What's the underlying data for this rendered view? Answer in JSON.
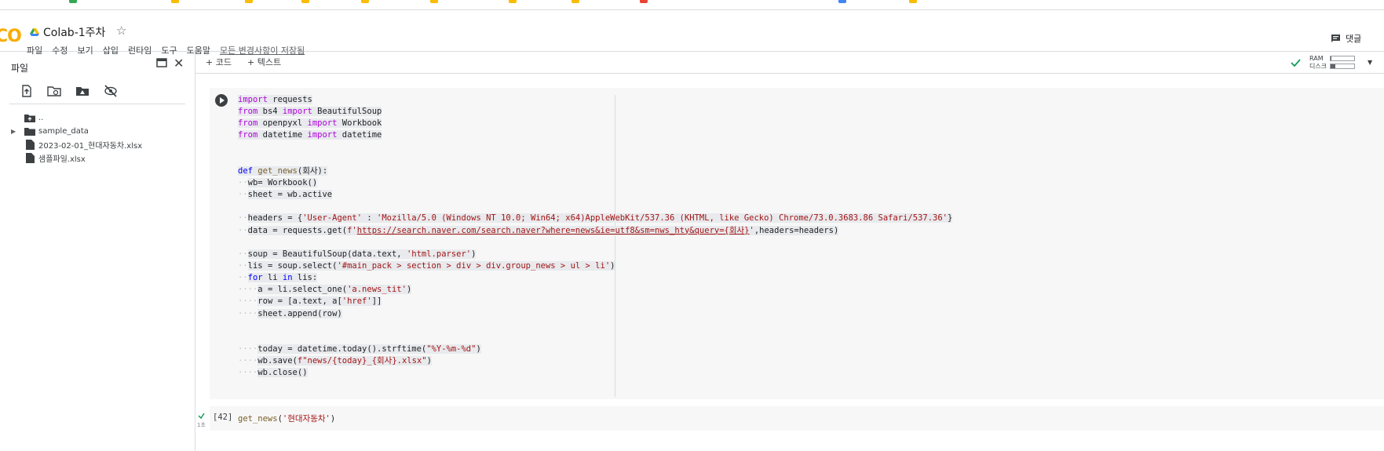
{
  "app": {
    "logo_text": "CO",
    "title": "Colab-1주차"
  },
  "menu": [
    "파일",
    "수정",
    "보기",
    "삽입",
    "런타임",
    "도구",
    "도움말"
  ],
  "saved_status": "모든 변경사항이 저장됨",
  "header": {
    "comments_label": "댓글"
  },
  "sidebar": {
    "title": "파일",
    "items": [
      {
        "label": "..",
        "icon": "folder-up-icon"
      },
      {
        "label": "sample_data",
        "icon": "folder-icon"
      },
      {
        "label": "2023-02-01_현대자동차.xlsx",
        "icon": "file-icon"
      },
      {
        "label": "샘플파일.xlsx",
        "icon": "file-icon"
      }
    ]
  },
  "toolbar": {
    "add_code": "+ 코드",
    "add_text": "+ 텍스트"
  },
  "resources": {
    "ram_label": "RAM",
    "disk_label": "디스크",
    "ram_fill": 0.05,
    "disk_fill": 0.2
  },
  "cell1": {
    "lines": [
      "import requests",
      "from bs4 import BeautifulSoup",
      "from openpyxl import Workbook",
      "from datetime import datetime",
      "",
      "",
      "def get_news(회사):",
      "  wb= Workbook()",
      "  sheet = wb.active",
      "",
      "  headers = {'User-Agent' : 'Mozilla/5.0 (Windows NT 10.0; Win64; x64)AppleWebKit/537.36 (KHTML, like Gecko) Chrome/73.0.3683.86 Safari/537.36'}",
      "  data = requests.get(f'https://search.naver.com/search.naver?where=news&ie=utf8&sm=nws_hty&query={회사}',headers=headers)",
      "",
      "  soup = BeautifulSoup(data.text, 'html.parser')",
      "  lis = soup.select('#main_pack > section > div > div.group_news > ul > li')",
      "  for li in lis:",
      "    a = li.select_one('a.news_tit')",
      "    row = [a.text, a['href']]",
      "    sheet.append(row)",
      "",
      "",
      "    today = datetime.today().strftime(\"%Y-%m-%d\")",
      "    wb.save(f\"news/{today}_{회사}.xlsx\")",
      "    wb.close()"
    ]
  },
  "cell2": {
    "exec_count": "[42]",
    "time": "1초",
    "code": "get_news('현대자동차')"
  }
}
